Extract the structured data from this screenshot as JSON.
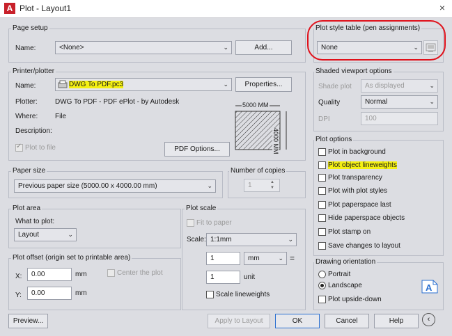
{
  "window": {
    "title": "Plot - Layout1",
    "close_icon": "×"
  },
  "page_setup": {
    "group_label": "Page setup",
    "name_label": "Name:",
    "name_value": "<None>",
    "add_button": "Add..."
  },
  "plot_style_table": {
    "group_label": "Plot style table (pen assignments)",
    "value": "None"
  },
  "printer": {
    "group_label": "Printer/plotter",
    "name_label": "Name:",
    "name_value": "DWG To PDF.pc3",
    "properties_button": "Properties...",
    "plotter_label": "Plotter:",
    "plotter_value": "DWG To PDF - PDF ePlot - by Autodesk",
    "where_label": "Where:",
    "where_value": "File",
    "description_label": "Description:",
    "plot_to_file_label": "Plot to file",
    "pdf_options_button": "PDF Options...",
    "preview_width": "5000 MM",
    "preview_height": "4000 MM"
  },
  "paper_size": {
    "group_label": "Paper size",
    "value": "Previous paper size  (5000.00 x 4000.00 mm)"
  },
  "copies": {
    "label": "Number of copies",
    "value": "1"
  },
  "plot_area": {
    "group_label": "Plot area",
    "what_label": "What to plot:",
    "value": "Layout"
  },
  "plot_offset": {
    "group_label": "Plot offset (origin set to printable area)",
    "x_label": "X:",
    "x_value": "0.00",
    "y_label": "Y:",
    "y_value": "0.00",
    "unit": "mm",
    "center_label": "Center the plot"
  },
  "plot_scale": {
    "group_label": "Plot scale",
    "fit_label": "Fit to paper",
    "scale_label": "Scale:",
    "scale_value": "1:1mm",
    "top_value": "1",
    "unit_value": "mm",
    "bottom_value": "1",
    "unit_label": "unit",
    "equals": "=",
    "scale_lineweights_label": "Scale lineweights"
  },
  "shaded": {
    "group_label": "Shaded viewport options",
    "shade_plot_label": "Shade plot",
    "shade_plot_value": "As displayed",
    "quality_label": "Quality",
    "quality_value": "Normal",
    "dpi_label": "DPI",
    "dpi_value": "100"
  },
  "plot_options": {
    "group_label": "Plot options",
    "items": [
      {
        "label": "Plot in background",
        "checked": false
      },
      {
        "label": "Plot object lineweights",
        "checked": false
      },
      {
        "label": "Plot transparency",
        "checked": false
      },
      {
        "label": "Plot with plot styles",
        "checked": false
      },
      {
        "label": "Plot paperspace last",
        "checked": false
      },
      {
        "label": "Hide paperspace objects",
        "checked": false
      },
      {
        "label": "Plot stamp on",
        "checked": false
      },
      {
        "label": "Save changes to layout",
        "checked": false
      }
    ]
  },
  "orientation": {
    "group_label": "Drawing orientation",
    "portrait_label": "Portrait",
    "landscape_label": "Landscape",
    "upside_down_label": "Plot upside-down"
  },
  "buttons": {
    "preview": "Preview...",
    "apply": "Apply to Layout",
    "ok": "OK",
    "cancel": "Cancel",
    "help": "Help"
  },
  "colors": {
    "highlight": "#f4f012",
    "annotation_red": "#e0101a",
    "primary_border": "#2a6fd0"
  }
}
